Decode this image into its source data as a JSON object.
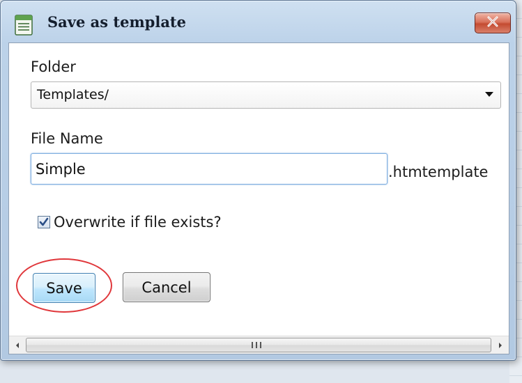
{
  "window": {
    "title": "Save as template"
  },
  "form": {
    "folder_label": "Folder",
    "folder_value": "Templates/",
    "filename_label": "File Name",
    "filename_value": "Simple",
    "filename_suffix": ".htmtemplate",
    "overwrite_label": "Overwrite if file exists?",
    "overwrite_checked": true
  },
  "buttons": {
    "save_label": "Save",
    "cancel_label": "Cancel"
  },
  "scrollbar": {
    "grip_glyph": "III"
  },
  "colors": {
    "highlight": "#e0373b",
    "close_button": "#c44b31",
    "input_focus_border": "#7eaee0",
    "checkmark": "#2b4f87"
  },
  "icons": {
    "app": "notepad-document-icon",
    "close": "close-x-icon",
    "dropdown": "triangle-down-icon",
    "check": "checkmark-icon",
    "scroll_left": "scroll-left-arrow-icon",
    "scroll_right": "scroll-right-arrow-icon"
  }
}
